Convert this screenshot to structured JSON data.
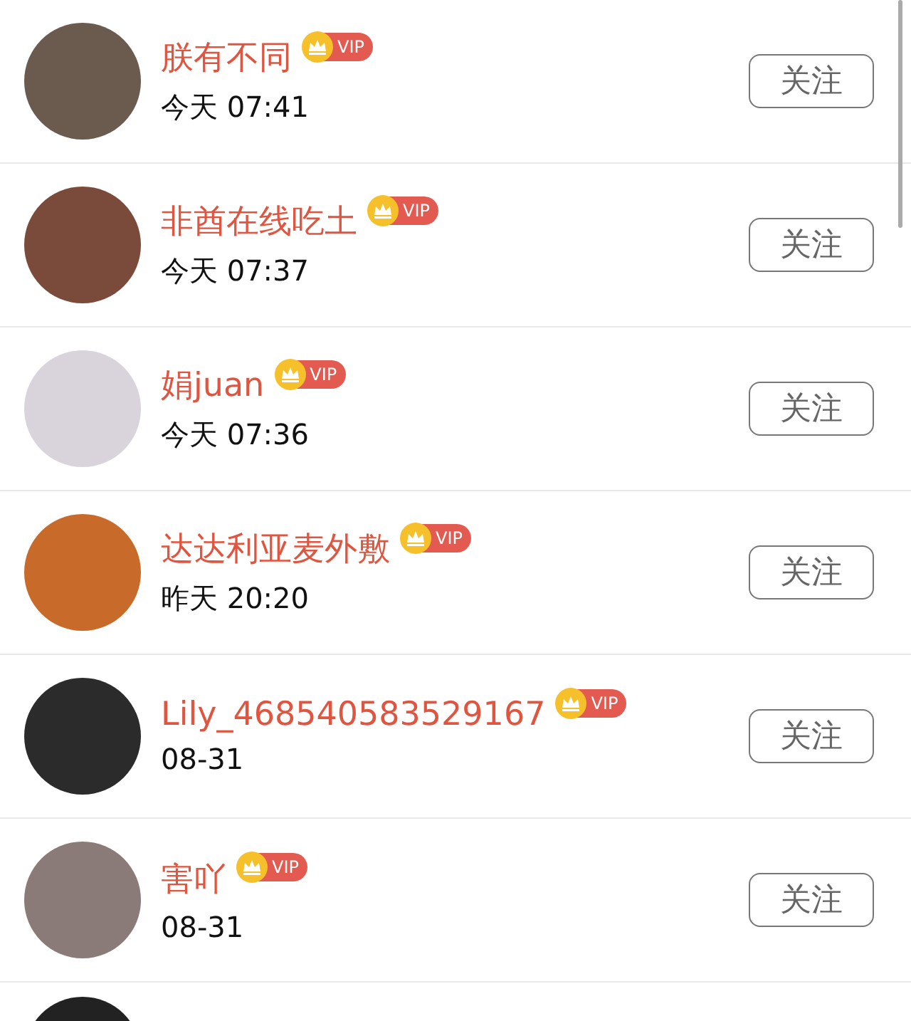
{
  "users": [
    {
      "name": "朕有不同",
      "vip": "VIP",
      "time": "今天 07:41",
      "follow": "关注"
    },
    {
      "name": "非酋在线吃土",
      "vip": "VIP",
      "time": "今天 07:37",
      "follow": "关注"
    },
    {
      "name": "娟juan",
      "vip": "VIP",
      "time": "今天 07:36",
      "follow": "关注"
    },
    {
      "name": "达达利亚麦外敷",
      "vip": "VIP",
      "time": "昨天 20:20",
      "follow": "关注"
    },
    {
      "name": "Lily_468540583529167",
      "vip": "VIP",
      "time": "08-31",
      "follow": "关注"
    },
    {
      "name": "害吖",
      "vip": "VIP",
      "time": "08-31",
      "follow": "关注"
    }
  ]
}
